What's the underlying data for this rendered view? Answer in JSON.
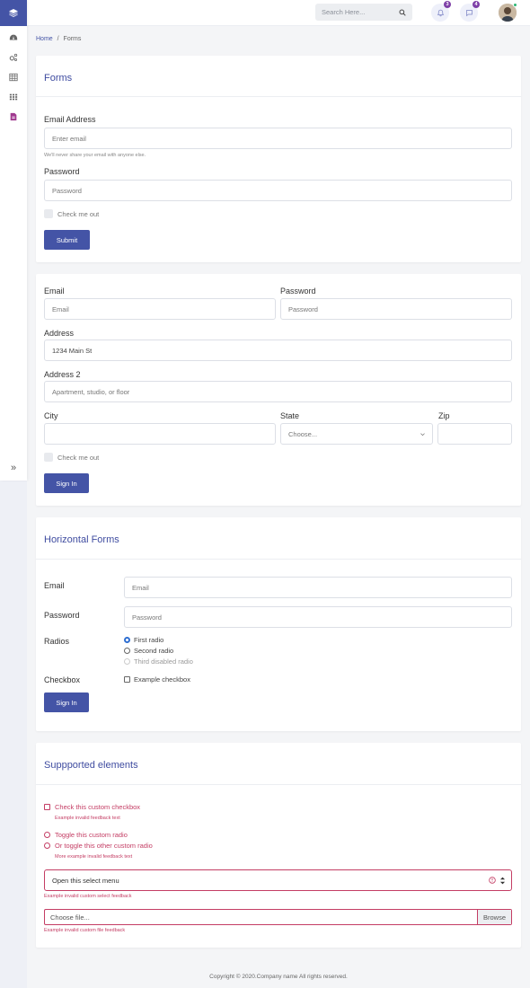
{
  "header": {
    "search_placeholder": "Search Here...",
    "notifications_count": "3",
    "messages_count": "4"
  },
  "breadcrumb": {
    "home": "Home",
    "separator": "/",
    "current": "Forms"
  },
  "card1": {
    "title": "Forms",
    "email_label": "Email Address",
    "email_placeholder": "Enter email",
    "email_help": "We'll never share your email with anyone else.",
    "password_label": "Password",
    "password_placeholder": "Password",
    "check_label": "Check me out",
    "submit_label": "Submit"
  },
  "card2": {
    "email_label": "Email",
    "email_placeholder": "Email",
    "password_label": "Password",
    "password_placeholder": "Password",
    "address_label": "Address",
    "address_value": "1234 Main St",
    "address2_label": "Address 2",
    "address2_placeholder": "Apartment, studio, or floor",
    "city_label": "City",
    "state_label": "State",
    "state_value": "Choose...",
    "zip_label": "Zip",
    "check_label": "Check me out",
    "signin_label": "Sign In"
  },
  "card3": {
    "title": "Horizontal Forms",
    "email_label": "Email",
    "email_placeholder": "Email",
    "password_label": "Password",
    "password_placeholder": "Password",
    "radios_label": "Radios",
    "radios": [
      "First radio",
      "Second radio",
      "Third disabled radio"
    ],
    "checkbox_label": "Checkbox",
    "checkbox_option": "Example checkbox",
    "signin_label": "Sign In"
  },
  "card4": {
    "title": "Suppported elements",
    "custom_checkbox": "Check this custom checkbox",
    "checkbox_feedback": "Example invalid feedback text",
    "radio1": "Toggle this custom radio",
    "radio2": "Or toggle this other custom radio",
    "radio_feedback": "More example invalid feedback text",
    "select_value": "Open this select menu",
    "select_feedback": "Example invalid custom select feedback",
    "file_placeholder": "Choose file...",
    "browse_label": "Browse",
    "file_feedback": "Example invalid custom file feedback"
  },
  "footer": {
    "text": "Copyright © 2020.Company name All rights reserved."
  },
  "colors": {
    "accent": "#4454a6",
    "invalid": "#c43d64",
    "badge": "#7e3fa7"
  },
  "icons": [
    "layers-icon",
    "dashboard-icon",
    "gears-icon",
    "table-icon",
    "grid-icon",
    "document-icon",
    "chevrons-right-icon",
    "search-icon",
    "bell-icon",
    "chat-icon"
  ]
}
